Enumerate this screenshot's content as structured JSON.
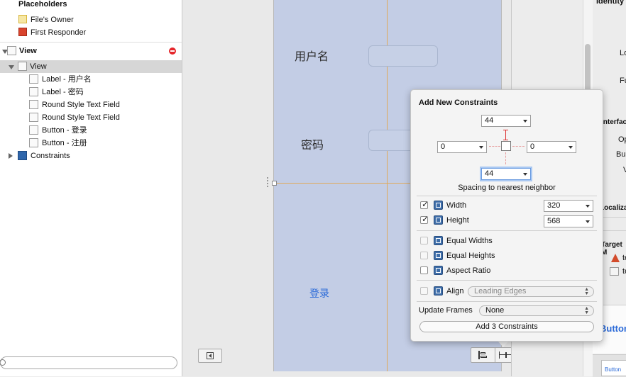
{
  "outline": {
    "placeholders_header": "Placeholders",
    "files_owner": "File's Owner",
    "first_responder": "First Responder",
    "view_group": "View",
    "view_item": "View",
    "children": [
      "Label - 用户名",
      "Label - 密码",
      "Round Style Text Field",
      "Round Style Text Field",
      "Button - 登录",
      "Button - 注册"
    ],
    "constraints": "Constraints"
  },
  "canvas": {
    "username_label": "用户名",
    "password_label": "密码",
    "login_button": "登录"
  },
  "inspector": {
    "labels": [
      "Identity",
      "Lo",
      "Fu",
      "Interfac",
      "Op",
      "Bui",
      "V",
      "Localizati",
      "Target M",
      "te",
      "te",
      "Button",
      "Button"
    ]
  },
  "popover": {
    "title": "Add New Constraints",
    "top_value": "44",
    "left_value": "0",
    "right_value": "0",
    "bottom_value": "44",
    "spacing_caption": "Spacing to nearest neighbor",
    "width_label": "Width",
    "width_value": "320",
    "height_label": "Height",
    "height_value": "568",
    "equal_widths": "Equal Widths",
    "equal_heights": "Equal Heights",
    "aspect_ratio": "Aspect Ratio",
    "align_label": "Align",
    "align_value": "Leading Edges",
    "update_frames_label": "Update Frames",
    "update_frames_value": "None",
    "add_button": "Add 3 Constraints"
  }
}
